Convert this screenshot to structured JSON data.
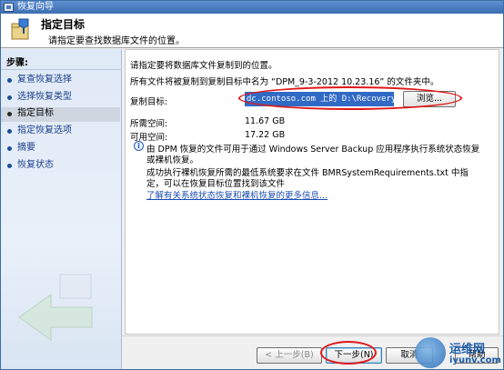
{
  "window": {
    "title": "恢复向导"
  },
  "header": {
    "title": "指定目标",
    "subtitle": "请指定要查找数据库文件的位置。"
  },
  "sidebar": {
    "steps_title": "步骤:",
    "items": [
      {
        "label": "复查恢复选择",
        "current": false
      },
      {
        "label": "选择恢复类型",
        "current": false
      },
      {
        "label": "指定目标",
        "current": true
      },
      {
        "label": "指定恢复选项",
        "current": false
      },
      {
        "label": "摘要",
        "current": false
      },
      {
        "label": "恢复状态",
        "current": false
      }
    ]
  },
  "main": {
    "intro": "请指定要将数据库文件复制到的位置。",
    "copy_note": "所有文件将被复制到复制目标中名为 “DPM_9-3-2012 10.23.16” 的文件夹中。",
    "target_label": "复制目标:",
    "target_value": "dc.contoso.com 上的 D:\\Recovery",
    "browse_label": "浏览...",
    "required_space_label": "所需空间:",
    "required_space_value": "11.67 GB",
    "available_space_label": "可用空间:",
    "available_space_value": "17.22 GB",
    "info_line1": "由 DPM 恢复的文件可用于通过 Windows Server Backup 应用程序执行系统状态恢复",
    "info_line2": "或裸机恢复。",
    "info_line3": "成功执行裸机恢复所需的最低系统要求在文件 BMRSystemRequirements.txt 中指",
    "info_line4": "定，可以在恢复目标位置找到该文件",
    "info_link": "了解有关系统状态恢复和裸机恢复的更多信息..."
  },
  "footer": {
    "back_label": "< 上一步(B)",
    "next_label": "下一步(N)",
    "cancel_label": "取消",
    "help_label": "帮助"
  },
  "watermark": {
    "text1": "运维网",
    "text2": "iyunv.com"
  },
  "colors": {
    "accent": "#316ac5",
    "annotation": "#e01818"
  }
}
